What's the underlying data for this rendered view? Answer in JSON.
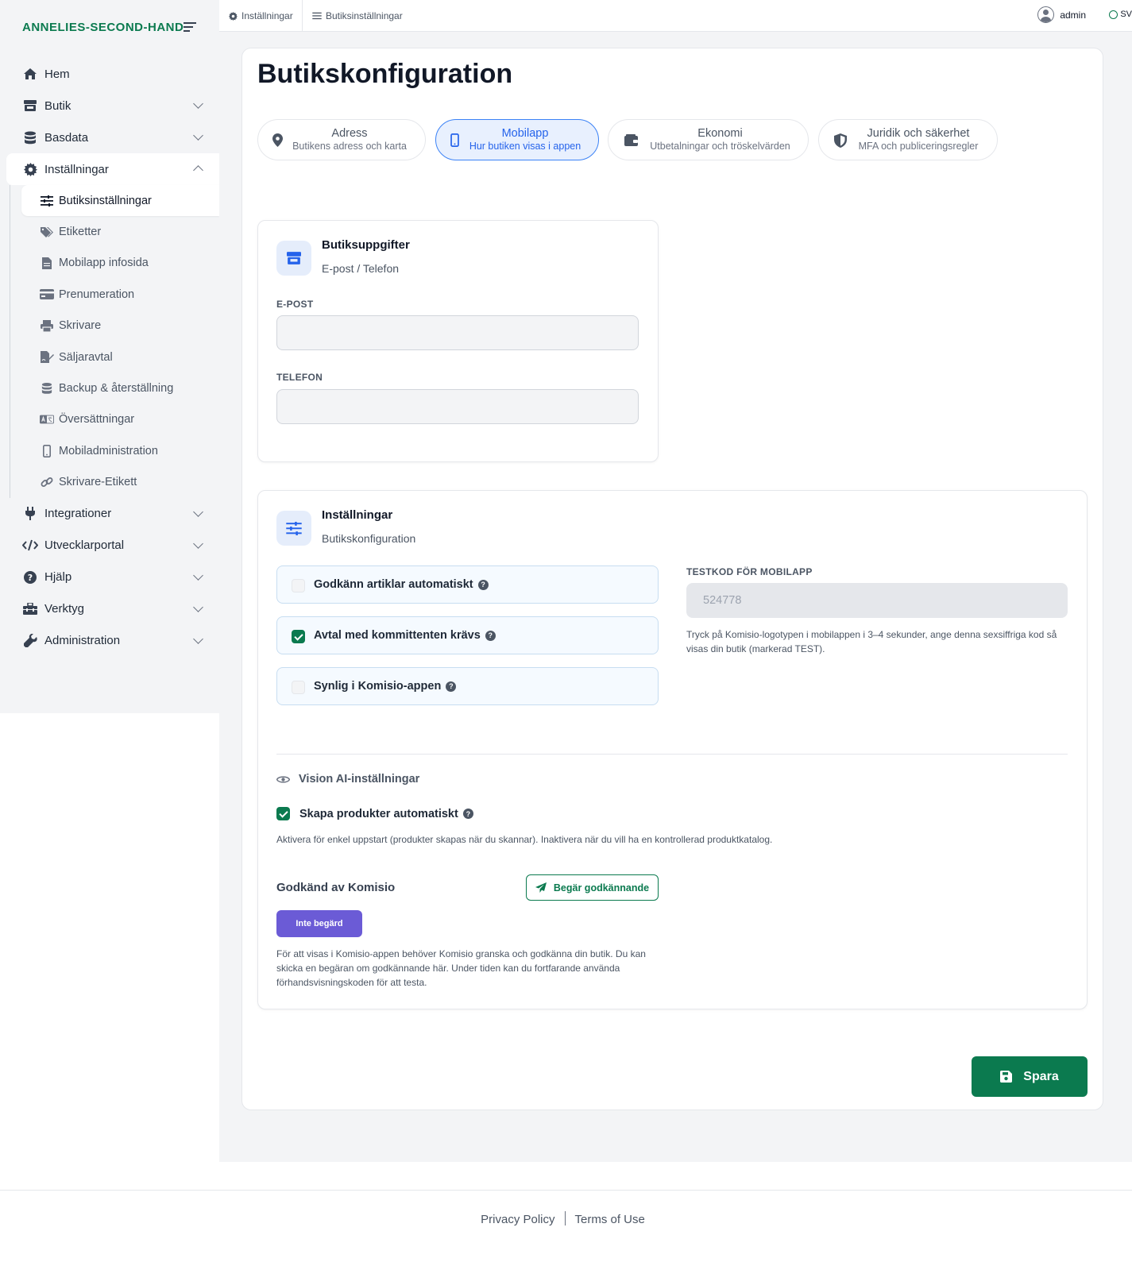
{
  "brand": "ANNELIES-SECOND-HAND",
  "sidebar": {
    "items": [
      {
        "label": "Hem",
        "icon": "home-icon"
      },
      {
        "label": "Butik",
        "icon": "store-icon"
      },
      {
        "label": "Basdata",
        "icon": "database-icon"
      },
      {
        "label": "Inställningar",
        "icon": "gear-icon"
      }
    ],
    "subitems": [
      {
        "label": "Butiksinställningar",
        "icon": "sliders-icon"
      },
      {
        "label": "Etiketter",
        "icon": "tags-icon"
      },
      {
        "label": "Mobilapp infosida",
        "icon": "file-icon"
      },
      {
        "label": "Prenumeration",
        "icon": "credit-card-icon"
      },
      {
        "label": "Skrivare",
        "icon": "printer-icon"
      },
      {
        "label": "Säljaravtal",
        "icon": "signature-icon"
      },
      {
        "label": "Backup & återställning",
        "icon": "database-icon"
      },
      {
        "label": "Översättningar",
        "icon": "language-icon"
      },
      {
        "label": "Mobiladministration",
        "icon": "mobile-icon"
      },
      {
        "label": "Skrivare-Etikett",
        "icon": "link-icon"
      }
    ],
    "items_after": [
      {
        "label": "Integrationer",
        "icon": "plug-icon"
      },
      {
        "label": "Utvecklarportal",
        "icon": "code-icon"
      },
      {
        "label": "Hjälp",
        "icon": "question-circle-icon"
      },
      {
        "label": "Verktyg",
        "icon": "toolbox-icon"
      },
      {
        "label": "Administration",
        "icon": "wrench-icon"
      }
    ]
  },
  "topbar": {
    "crumb1": "Inställningar",
    "crumb2": "Butiksinställningar",
    "user": "admin",
    "lang": "SV"
  },
  "page": {
    "title": "Butikskonfiguration"
  },
  "tabs": [
    {
      "title": "Adress",
      "subtitle": "Butikens adress och karta",
      "icon": "map-marker-icon"
    },
    {
      "title": "Mobilapp",
      "subtitle": "Hur butiken visas i appen",
      "icon": "mobile-icon"
    },
    {
      "title": "Ekonomi",
      "subtitle": "Utbetalningar och tröskelvärden",
      "icon": "wallet-icon"
    },
    {
      "title": "Juridik och säkerhet",
      "subtitle": "MFA och publiceringsregler",
      "icon": "shield-icon"
    }
  ],
  "store_panel": {
    "title": "Butiksuppgifter",
    "subtitle": "E-post / Telefon",
    "email_label": "E-POST",
    "email_value": "",
    "phone_label": "TELEFON",
    "phone_value": ""
  },
  "settings_panel": {
    "title": "Inställningar",
    "subtitle": "Butikskonfiguration",
    "options": [
      {
        "label": "Godkänn artiklar automatiskt",
        "checked": false
      },
      {
        "label": "Avtal med kommittenten krävs",
        "checked": true
      },
      {
        "label": "Synlig i Komisio-appen",
        "checked": false
      }
    ],
    "testcode_label": "TESTKOD FÖR MOBILAPP",
    "testcode_value": "524778",
    "testcode_hint": "Tryck på Komisio-logotypen i mobilappen i 3–4 sekunder, ange denna sexsiffriga kod så visas din butik (markerad TEST).",
    "vision_heading": "Vision AI-inställningar",
    "auto_create_label": "Skapa produkter automatiskt",
    "auto_create_checked": true,
    "auto_create_hint": "Aktivera för enkel uppstart (produkter skapas när du skannar). Inaktivera när du vill ha en kontrollerad produktkatalog.",
    "approved_label": "Godkänd av Komisio",
    "request_button": "Begär godkännande",
    "status_badge": "Inte begärd",
    "approved_hint": "För att visas i Komisio-appen behöver Komisio granska och godkänna din butik. Du kan skicka en begäran om godkännande här. Under tiden kan du fortfarande använda förhandsvisningskoden för att testa."
  },
  "save_button": "Spara",
  "footer": {
    "privacy": "Privacy Policy",
    "terms": "Terms of Use"
  },
  "colors": {
    "brand": "#0b7a4f",
    "accent_blue": "#2563eb",
    "badge": "#6b5bd6"
  }
}
